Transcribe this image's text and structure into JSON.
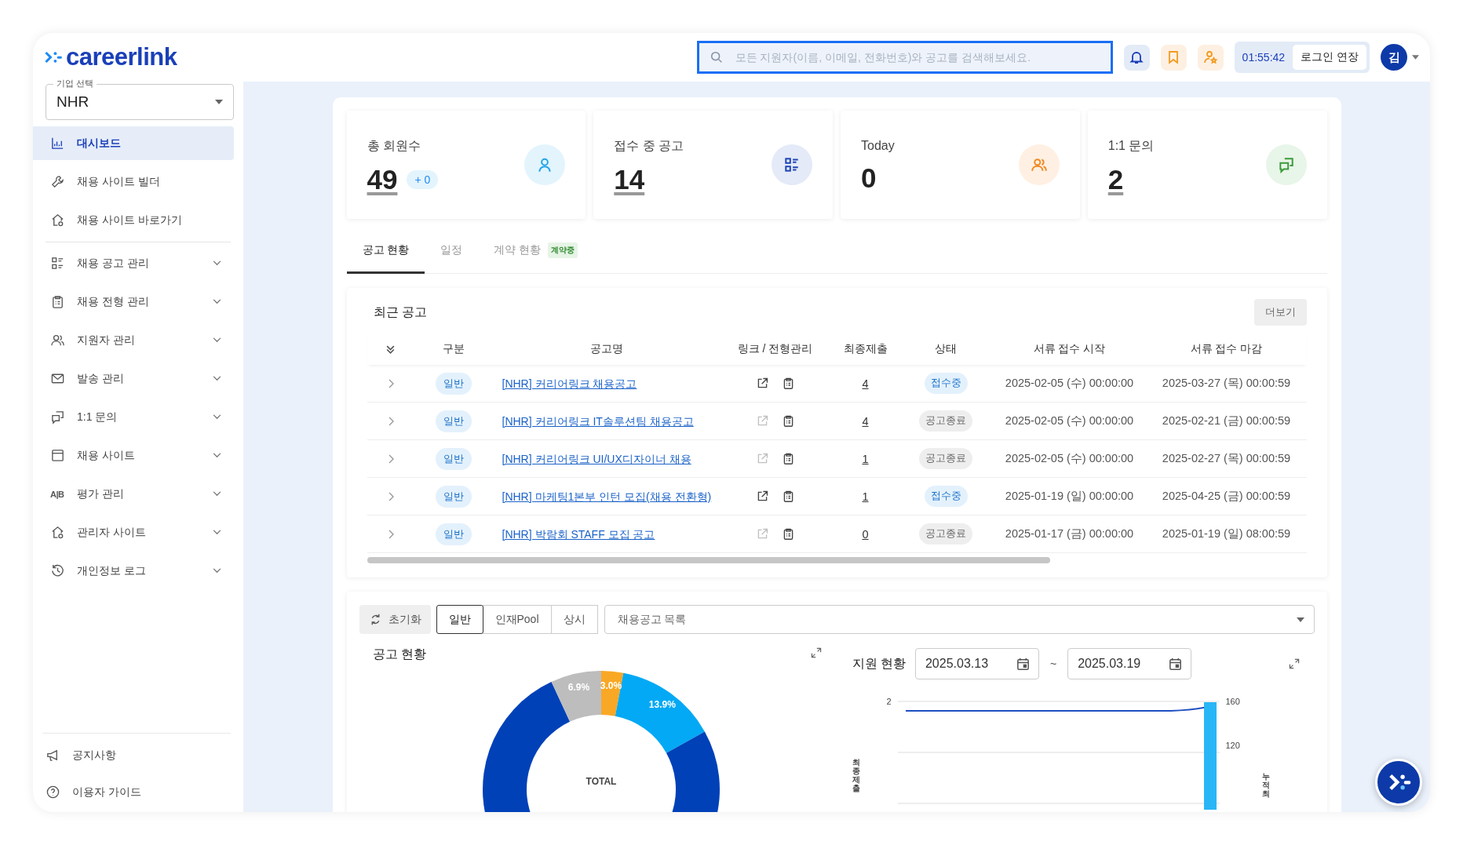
{
  "header": {
    "logo": "careerlink",
    "search": {
      "placeholder": "모든 지원자(이름, 이메일, 전화번호)와 공고를 검색해보세요."
    },
    "timer": "01:55:42",
    "extend_button": "로그인 연장",
    "avatar": "김"
  },
  "sidebar": {
    "company_select": {
      "label": "기업 선택",
      "value": "NHR"
    },
    "sections": [
      {
        "items": [
          {
            "label": "대시보드",
            "selected": true
          },
          {
            "label": "채용 사이트 빌더",
            "selected": false
          },
          {
            "label": "채용 사이트 바로가기",
            "selected": false
          }
        ]
      },
      {
        "items": [
          {
            "label": "채용 공고 관리",
            "selected": false,
            "expanded": false
          },
          {
            "label": "채용 전형 관리",
            "selected": false,
            "expanded": false
          },
          {
            "label": "지원자 관리",
            "selected": false,
            "expanded": false
          },
          {
            "label": "발송 관리",
            "selected": false,
            "expanded": false
          },
          {
            "label": "1:1 문의",
            "selected": false,
            "expanded": false
          },
          {
            "label": "채용 사이트",
            "selected": false,
            "expanded": false
          },
          {
            "label": "평가 관리",
            "selected": false,
            "expanded": false,
            "icon_text": "A|B"
          },
          {
            "label": "관리자 사이트",
            "selected": false,
            "expanded": false
          },
          {
            "label": "개인정보 로그",
            "selected": false,
            "expanded": false
          }
        ]
      }
    ],
    "footer_items": [
      {
        "label": "공지사항"
      },
      {
        "label": "이용자 가이드"
      }
    ]
  },
  "stats": [
    {
      "label": "총 회원수",
      "value": "49",
      "link": true,
      "delta": "+ 0",
      "color": "#22a5e8"
    },
    {
      "label": "접수 중 공고",
      "value": "14",
      "link": true,
      "color": "#1f44b8"
    },
    {
      "label": "Today",
      "value": "0",
      "link": false,
      "color": "#f08a24"
    },
    {
      "label": "1:1 문의",
      "value": "2",
      "link": true,
      "color": "#3a9b3a"
    }
  ],
  "tabs": [
    {
      "label": "공고 현황",
      "selected": true
    },
    {
      "label": "일정",
      "selected": false
    },
    {
      "label": "계약 현황",
      "selected": false,
      "badge": "계약중"
    }
  ],
  "recent_postings": {
    "title": "최근 공고",
    "more_button": "더보기",
    "columns": [
      "구분",
      "공고명",
      "링크 / 전형관리",
      "최종제출",
      "상태",
      "서류 접수 시작",
      "서류 접수 마감"
    ],
    "rows": [
      {
        "type": "일반",
        "title": "[NHR] 커리어링크 채용공고",
        "link_active": true,
        "submissions": "4",
        "status": "접수중",
        "open": true,
        "start": "2025-02-05 (수) 00:00:00",
        "end": "2025-03-27 (목) 00:00:59"
      },
      {
        "type": "일반",
        "title": "[NHR] 커리어링크 IT솔루션팀 채용공고",
        "link_active": false,
        "submissions": "4",
        "status": "공고종료",
        "open": false,
        "start": "2025-02-05 (수) 00:00:00",
        "end": "2025-02-21 (금) 00:00:59"
      },
      {
        "type": "일반",
        "title": "[NHR] 커리어링크 UI/UX디자이너 채용",
        "link_active": false,
        "submissions": "1",
        "status": "공고종료",
        "open": false,
        "start": "2025-02-05 (수) 00:00:00",
        "end": "2025-02-27 (목) 00:00:59"
      },
      {
        "type": "일반",
        "title": "[NHR] 마케팅1본부 인턴 모집(채용 전환형)",
        "link_active": true,
        "submissions": "1",
        "status": "접수중",
        "open": true,
        "start": "2025-01-19 (일) 00:00:00",
        "end": "2025-04-25 (금) 00:00:59"
      },
      {
        "type": "일반",
        "title": "[NHR] 박람회 STAFF 모집 공고",
        "link_active": false,
        "submissions": "0",
        "status": "공고종료",
        "open": false,
        "start": "2025-01-17 (금) 00:00:00",
        "end": "2025-01-19 (일) 08:00:59"
      }
    ]
  },
  "filters": {
    "reset_button": "초기화",
    "segments": [
      {
        "label": "일반",
        "selected": true
      },
      {
        "label": "인재Pool",
        "selected": false
      },
      {
        "label": "상시",
        "selected": false
      }
    ],
    "posting_select": {
      "placeholder": "채용공고 목록"
    }
  },
  "posting_status": {
    "title": "공고 현황",
    "center_label": "TOTAL",
    "chart_data": {
      "type": "donut",
      "values": [
        3.0,
        13.9,
        76.2,
        6.9
      ],
      "value_labels": [
        "3.0%",
        "13.9%",
        null,
        "6.9%"
      ]
    }
  },
  "application_status": {
    "title": "지원 현황",
    "date_from": "2025.03.13",
    "separator": "~",
    "date_to": "2025.03.19",
    "left_ticks": [
      "2"
    ],
    "right_ticks": [
      "160",
      "120"
    ],
    "left_axis_title": "최종제출",
    "right_axis_title": "누적최"
  }
}
